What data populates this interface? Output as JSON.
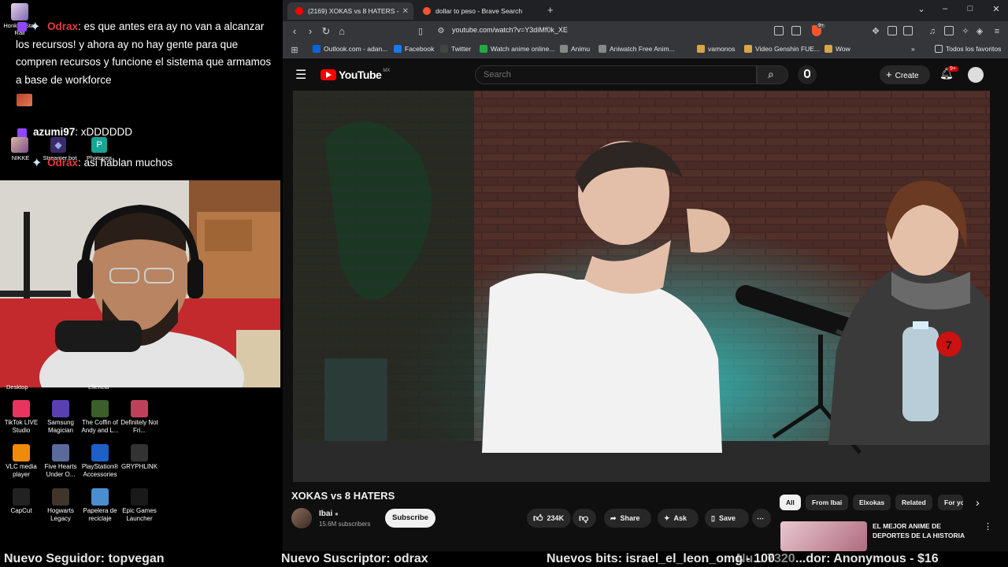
{
  "chat": {
    "messages": [
      {
        "user": "Odrax",
        "text": ": es que antes era ay no van a alcanzar los recursos! y ahora ay no hay gente para que compren recursos y funcione el sistema que armamos a base de workforce"
      },
      {
        "user": "azumi97",
        "text": ": xDDDDDD"
      },
      {
        "user": "Odrax",
        "text": ": asi hablan muchos"
      }
    ]
  },
  "desktop": {
    "top_labels": [
      "Honkai: Star Rail",
      "NIKKE",
      "Streamer.bot",
      "Photopea"
    ],
    "partial_labels": [
      "Desktop",
      "Ellencia"
    ],
    "icons": [
      {
        "label": "TikTok LIVE Studio",
        "icon": "tiktok-icon",
        "color": "#e8345e"
      },
      {
        "label": "Samsung Magician",
        "icon": "samsung-magician-icon",
        "color": "#5a3fb0"
      },
      {
        "label": "The Coffin of Andy and L...",
        "icon": "game-icon",
        "color": "#3b5e2b"
      },
      {
        "label": "Definitely Not Fri...",
        "icon": "game-icon",
        "color": "#c0405a"
      },
      {
        "label": "VLC media player",
        "icon": "vlc-icon",
        "color": "#f08a0a"
      },
      {
        "label": "Five Hearts Under O...",
        "icon": "game-icon",
        "color": "#5a6a9a"
      },
      {
        "label": "PlayStation® Accessories",
        "icon": "playstation-icon",
        "color": "#1f5fc8"
      },
      {
        "label": "GRYPHLINK",
        "icon": "gryphlink-icon",
        "color": "#333333"
      },
      {
        "label": "CapCut",
        "icon": "capcut-icon",
        "color": "#222222"
      },
      {
        "label": "Hogwarts Legacy",
        "icon": "game-icon",
        "color": "#40352a"
      },
      {
        "label": "Papelera de reciclaje",
        "icon": "recycle-bin-icon",
        "color": "#4a8ed0"
      },
      {
        "label": "Epic Games Launcher",
        "icon": "epic-games-icon",
        "color": "#1a1a1a"
      }
    ]
  },
  "browser": {
    "tabs": [
      {
        "label": "(2169) XOKAS vs 8 HATERS -",
        "favicon_color": "#ff0000",
        "active": true
      },
      {
        "label": "dollar to peso - Brave Search",
        "favicon_color": "#fb542b",
        "active": false
      }
    ],
    "new_tab": "+",
    "url": "youtube.com/watch?v=Y3diMf0k_XE",
    "bookmarks": [
      {
        "label": "Outlook.com - adan...",
        "color": "#0a64d6"
      },
      {
        "label": "Facebook",
        "color": "#1877f2"
      },
      {
        "label": "Twitter",
        "color": "#444444"
      },
      {
        "label": "Watch anime online...",
        "color": "#22aa44"
      },
      {
        "label": "Animu",
        "color": "#888888"
      },
      {
        "label": "Aniwatch Free Anim...",
        "color": "#888888"
      },
      {
        "label": "vamonos",
        "color": "#d6a64a"
      },
      {
        "label": "Video Genshin FUE...",
        "color": "#d6a64a"
      },
      {
        "label": "Wow",
        "color": "#d6a64a"
      }
    ],
    "all_bookmarks": "Todos los favoritos",
    "brave_badge": "9+"
  },
  "youtube": {
    "logo": "YouTube",
    "region": "MX",
    "search_placeholder": "Search",
    "create_label": "Create",
    "notif_count": "9+",
    "video_title": "XOKAS vs 8 HATERS",
    "channel": "Ibai",
    "subscribers": "15.6M subscribers",
    "subscribe_label": "Subscribe",
    "likes": "234K",
    "share_label": "Share",
    "ask_label": "Ask",
    "save_label": "Save",
    "chips": [
      "All",
      "From Ibai",
      "Elxokas",
      "Related",
      "For yo"
    ],
    "recommended_title": "EL MEJOR ANIME DE DEPORTES DE LA HISTORIA",
    "mic_flag": "7"
  },
  "ticker": {
    "follower": "Nuevo Seguidor: topvegan",
    "subscriber": "Nuevo Suscriptor: odrax",
    "bits": "Nuevos bits: israel_el_leon_omg - 100",
    "overlap": "Nu... 7320gx...",
    "donor": "...dor: Anonymous - $16"
  },
  "colors": {
    "chat_name_red": "#e53b3b",
    "youtube_red": "#ff0000",
    "twitch_purple": "#9147ff"
  }
}
